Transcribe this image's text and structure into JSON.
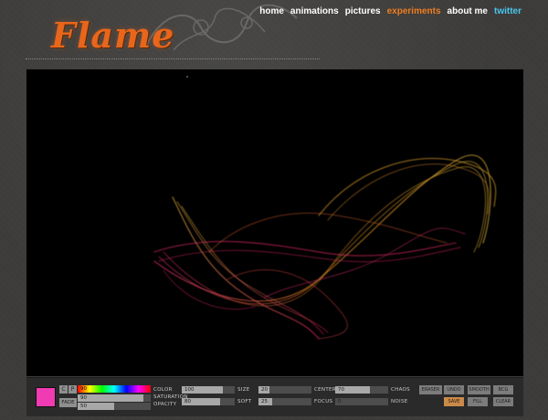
{
  "site": {
    "logo": "Flame"
  },
  "nav": [
    {
      "label": "home",
      "state": "normal"
    },
    {
      "label": "animations",
      "state": "normal"
    },
    {
      "label": "pictures",
      "state": "normal"
    },
    {
      "label": "experiments",
      "state": "active"
    },
    {
      "label": "about me",
      "state": "normal"
    },
    {
      "label": "twitter",
      "state": "twitter"
    }
  ],
  "colors": {
    "accent": "#ef7d20",
    "twitter": "#48c6ef",
    "swatch": "#f03bb2"
  },
  "controls": {
    "mini_buttons": {
      "c": "C",
      "p": "P"
    },
    "fade_label": "FADE",
    "color": {
      "label": "COLOR",
      "value": "90"
    },
    "saturation": {
      "label": "SATURATION",
      "value": "90",
      "level": 0.9
    },
    "opacity": {
      "label": "OPACITY",
      "value": "50",
      "level": 0.5
    },
    "size": {
      "label": "SIZE",
      "value": "100",
      "level": 0.78
    },
    "soft": {
      "label": "SOFT",
      "value": "80",
      "level": 0.72
    },
    "center": {
      "label": "CENTER",
      "value": "20",
      "level": 0.2
    },
    "focus": {
      "label": "FOCUS",
      "value": "25",
      "level": 0.25
    },
    "chaos": {
      "label": "CHAOS",
      "value": "70",
      "level": 0.65
    },
    "noise": {
      "label": "NOISE",
      "value": "0",
      "level": 0.0
    },
    "buttons": {
      "eraser": "ERASER",
      "undo": "UNDO",
      "smooth": "SMOOTH",
      "bcg": "BCG",
      "save": "SAVE",
      "fill": "FILL",
      "clear": "CLEAR"
    }
  }
}
